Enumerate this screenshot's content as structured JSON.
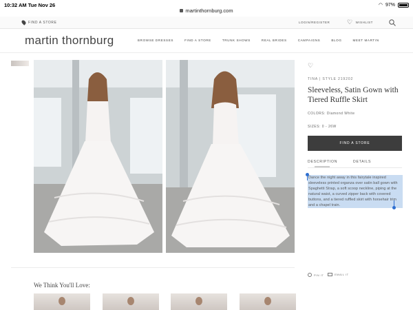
{
  "statusbar": {
    "time": "10:32 AM  Tue Nov 26",
    "url": "martinthornburg.com",
    "battery": "97%"
  },
  "utility": {
    "find_store": "FIND A STORE",
    "login": "LOGIN/REGISTER",
    "wishlist": "WISHLIST"
  },
  "header": {
    "logo": "martin thornburg",
    "nav": [
      "BROWSE DRESSES",
      "FIND A STORE",
      "TRUNK SHOWS",
      "REAL BRIDES",
      "CAMPAIGNS",
      "BLOG",
      "MEET MARTIN"
    ]
  },
  "product": {
    "style": "TINA | STYLE 219202",
    "title": "Sleeveless, Satin Gown with Tiered Ruffle Skirt",
    "colors": "COLORS: Diamond White",
    "sizes": "SIZES: 0 - 26W",
    "find_button": "FIND A STORE",
    "tabs": [
      "DESCRIPTION",
      "DETAILS"
    ],
    "description": "Dance the night away in this fairytale inspired sleeveless printed organza over satin ball gown with Spaghetti Strap, a soft scoop neckline, piping at the natural waist, a curved zipper back with covered buttons, and a tiered ruffled skirt with horsehair trim and a chapel train.",
    "share_pin": "PIN IT",
    "share_email": "EMAIL IT"
  },
  "recommendations": {
    "title": "We Think You'll Love:"
  }
}
